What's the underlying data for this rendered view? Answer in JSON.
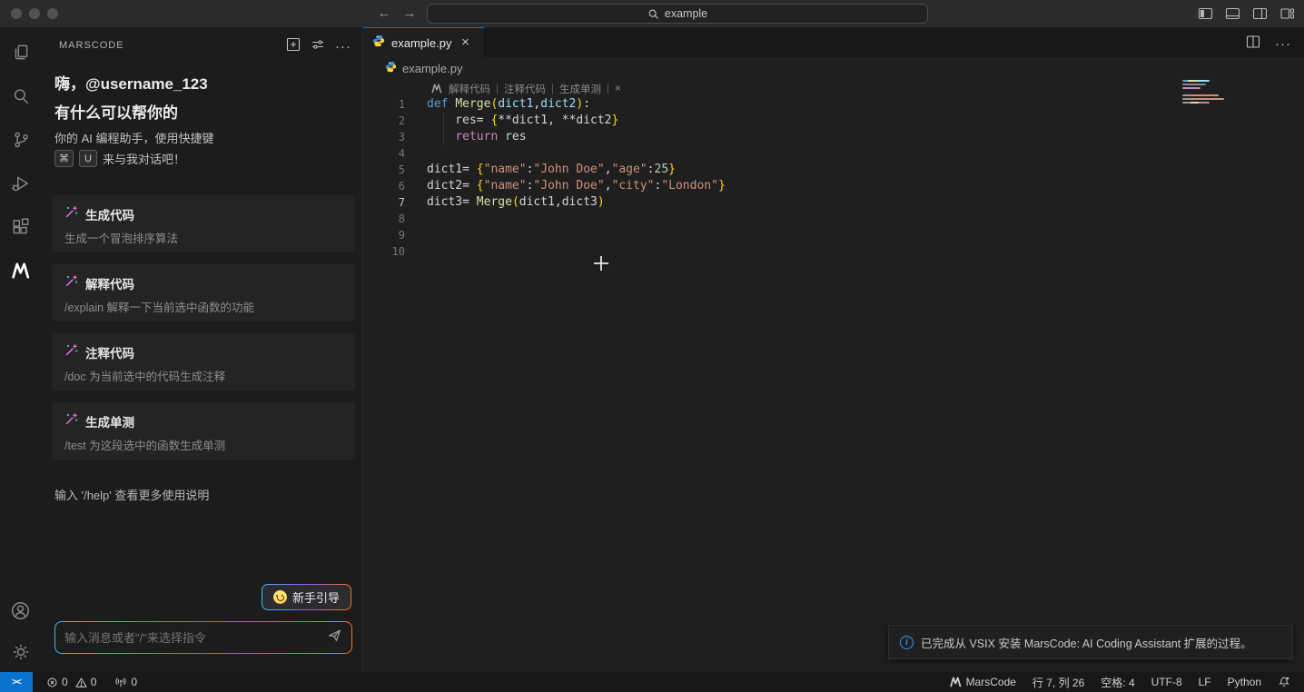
{
  "title_bar": {
    "search_value": "example"
  },
  "activity_bar": {
    "items": [
      "explorer-icon",
      "search-icon",
      "source-control-icon",
      "run-debug-icon",
      "extensions-icon",
      "marscode-icon"
    ],
    "bottom_items": [
      "account-icon",
      "settings-gear-icon"
    ]
  },
  "sidebar": {
    "title": "MARSCODE",
    "header_icons": [
      "new-chat-plus-icon",
      "sliders-icon",
      "more-ellipsis-icon"
    ],
    "greeting_line1": "嗨，@username_123",
    "greeting_line2": "有什么可以帮你的",
    "assistant_hint_line1": "你的 AI 编程助手，使用快捷键",
    "shortcut_key1": "⌘",
    "shortcut_key2": "U",
    "assistant_hint_line2": "来与我对话吧！",
    "cards": [
      {
        "title": "生成代码",
        "desc": "生成一个冒泡排序算法"
      },
      {
        "title": "解释代码",
        "desc": "/explain 解释一下当前选中函数的功能"
      },
      {
        "title": "注释代码",
        "desc": "/doc 为当前选中的代码生成注释"
      },
      {
        "title": "生成单测",
        "desc": "/test 为这段选中的函数生成单测"
      }
    ],
    "help_hint": "输入 '/help' 查看更多使用说明",
    "guide_button_label": "新手引导",
    "input_placeholder": "输入消息或者\"/\"来选择指令"
  },
  "editor": {
    "tab_label": "example.py",
    "breadcrumb_file": "example.py",
    "codelens": {
      "actions": [
        "解释代码",
        "注释代码",
        "生成单测"
      ],
      "close": "×"
    },
    "active_line": 7,
    "lines": [
      {
        "n": 1,
        "tokens": [
          {
            "t": "def ",
            "c": "k"
          },
          {
            "t": "Merge",
            "c": "f"
          },
          {
            "t": "(",
            "c": "b"
          },
          {
            "t": "dict1",
            "c": "v"
          },
          {
            "t": ",",
            "c": "p"
          },
          {
            "t": "dict2",
            "c": "v"
          },
          {
            "t": ")",
            "c": "b"
          },
          {
            "t": ":",
            "c": "p"
          }
        ]
      },
      {
        "n": 2,
        "tokens": [
          {
            "t": "    res= ",
            "c": "p"
          },
          {
            "t": "{",
            "c": "b"
          },
          {
            "t": "**dict1, **dict2",
            "c": "p"
          },
          {
            "t": "}",
            "c": "b"
          }
        ]
      },
      {
        "n": 3,
        "tokens": [
          {
            "t": "    ",
            "c": "p"
          },
          {
            "t": "return",
            "c": "c"
          },
          {
            "t": " res",
            "c": "p"
          }
        ]
      },
      {
        "n": 4,
        "tokens": []
      },
      {
        "n": 5,
        "tokens": [
          {
            "t": "dict1= ",
            "c": "p"
          },
          {
            "t": "{",
            "c": "b"
          },
          {
            "t": "\"name\"",
            "c": "s"
          },
          {
            "t": ":",
            "c": "p"
          },
          {
            "t": "\"John Doe\"",
            "c": "s"
          },
          {
            "t": ",",
            "c": "p"
          },
          {
            "t": "\"age\"",
            "c": "s"
          },
          {
            "t": ":",
            "c": "p"
          },
          {
            "t": "25",
            "c": "n"
          },
          {
            "t": "}",
            "c": "b"
          }
        ]
      },
      {
        "n": 6,
        "tokens": [
          {
            "t": "dict2= ",
            "c": "p"
          },
          {
            "t": "{",
            "c": "b"
          },
          {
            "t": "\"name\"",
            "c": "s"
          },
          {
            "t": ":",
            "c": "p"
          },
          {
            "t": "\"John Doe\"",
            "c": "s"
          },
          {
            "t": ",",
            "c": "p"
          },
          {
            "t": "\"city\"",
            "c": "s"
          },
          {
            "t": ":",
            "c": "p"
          },
          {
            "t": "\"London\"",
            "c": "s"
          },
          {
            "t": "}",
            "c": "b"
          }
        ]
      },
      {
        "n": 7,
        "tokens": [
          {
            "t": "dict3= ",
            "c": "p"
          },
          {
            "t": "Merge",
            "c": "f"
          },
          {
            "t": "(",
            "c": "b"
          },
          {
            "t": "dict1,dict3",
            "c": "p"
          },
          {
            "t": ")",
            "c": "b"
          }
        ]
      },
      {
        "n": 8,
        "tokens": []
      },
      {
        "n": 9,
        "tokens": []
      },
      {
        "n": 10,
        "tokens": []
      }
    ]
  },
  "notification": {
    "message": "已完成从 VSIX 安装 MarsCode: AI Coding Assistant 扩展的过程。"
  },
  "status_bar": {
    "error_count": "0",
    "warning_count": "0",
    "port_count": "0",
    "marscode_label": "MarsCode",
    "cursor_position": "行 7, 列 26",
    "indentation": "空格: 4",
    "encoding": "UTF-8",
    "eol": "LF",
    "language": "Python"
  },
  "colors": {
    "accent_blue": "#0078d4",
    "remote_indicator_bg": "#0a72cf",
    "info_icon_blue": "#3794ff",
    "tab_active_border": "#0078d4",
    "gradient_border": [
      "#38bdf8",
      "#8b5cf6",
      "#f97316"
    ],
    "string_orange": "#ce9178",
    "keyword_blue": "#569cd6",
    "function_yellow": "#dcdcaa"
  }
}
